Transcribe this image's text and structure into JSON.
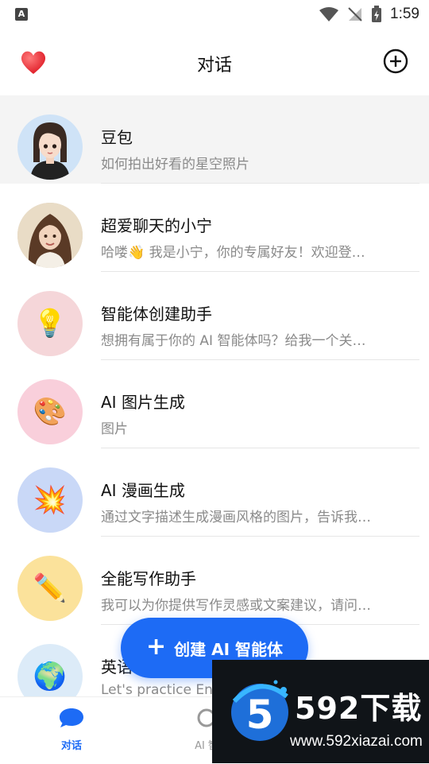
{
  "status_bar": {
    "time": "1:59",
    "left_badge": "A"
  },
  "header": {
    "title": "对话"
  },
  "chats": [
    {
      "title": "豆包",
      "subtitle": "如何拍出好看的星空照片",
      "avatar_icon": "doubao-avatar",
      "avatar_bg": "#cfe3f7"
    },
    {
      "title": "超爱聊天的小宁",
      "subtitle": "哈喽👋 我是小宁，你的专属好友！欢迎登…",
      "avatar_icon": "xiaoning-avatar",
      "avatar_bg": "#c9b7a1"
    },
    {
      "title": "智能体创建助手",
      "subtitle": "想拥有属于你的 AI 智能体吗？给我一个关…",
      "avatar_icon": "💡",
      "avatar_bg": "#f5d6d9"
    },
    {
      "title": "AI 图片生成",
      "subtitle": "图片",
      "avatar_icon": "🎨",
      "avatar_bg": "#f9cfdb"
    },
    {
      "title": "AI 漫画生成",
      "subtitle": "通过文字描述生成漫画风格的图片，告诉我…",
      "avatar_icon": "💥",
      "avatar_bg": "#c9d8f7"
    },
    {
      "title": "全能写作助手",
      "subtitle": "我可以为你提供写作灵感或文案建议，请问…",
      "avatar_icon": "✏️",
      "avatar_bg": "#fbe29b"
    },
    {
      "title": "英语",
      "subtitle": "Let's practice En",
      "avatar_icon": "🌍",
      "avatar_bg": "#dcebf8"
    }
  ],
  "fab": {
    "plus": "+",
    "label": "创建 AI 智能体"
  },
  "bottom_nav": {
    "chat_label": "对话",
    "ai_label": "AI 智"
  },
  "watermark": {
    "brand": "592下载",
    "url": "www.592xiazai.com"
  },
  "colors": {
    "accent": "#1d6bf5",
    "active_row": "#f4f4f4"
  }
}
